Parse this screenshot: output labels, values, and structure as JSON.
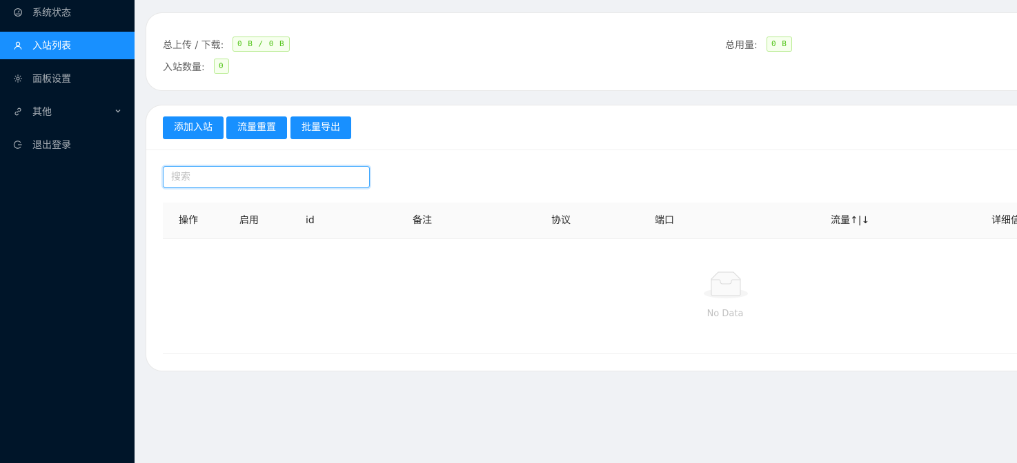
{
  "sidebar": {
    "items": [
      {
        "label": "系统状态",
        "icon": "dashboard-icon"
      },
      {
        "label": "入站列表",
        "icon": "user-icon",
        "active": true
      },
      {
        "label": "面板设置",
        "icon": "gear-icon"
      },
      {
        "label": "其他",
        "icon": "link-icon",
        "has_submenu": true
      },
      {
        "label": "退出登录",
        "icon": "logout-icon"
      }
    ]
  },
  "stats": {
    "upload_download_label": "总上传 / 下载:",
    "upload_download_value": "0 B / 0 B",
    "total_usage_label": "总用量:",
    "total_usage_value": "0 B",
    "inbound_count_label": "入站数量:",
    "inbound_count_value": "0"
  },
  "toolbar": {
    "add_label": "添加入站",
    "reset_label": "流量重置",
    "export_label": "批量导出"
  },
  "search": {
    "placeholder": "搜索"
  },
  "table": {
    "columns": [
      "操作",
      "启用",
      "id",
      "备注",
      "协议",
      "端口",
      "流量↑|↓",
      "详细信"
    ],
    "rows": [],
    "empty_text": "No Data"
  },
  "colors": {
    "sidebar_bg": "#001529",
    "accent": "#1890ff",
    "tag_green": "#52c41a"
  }
}
